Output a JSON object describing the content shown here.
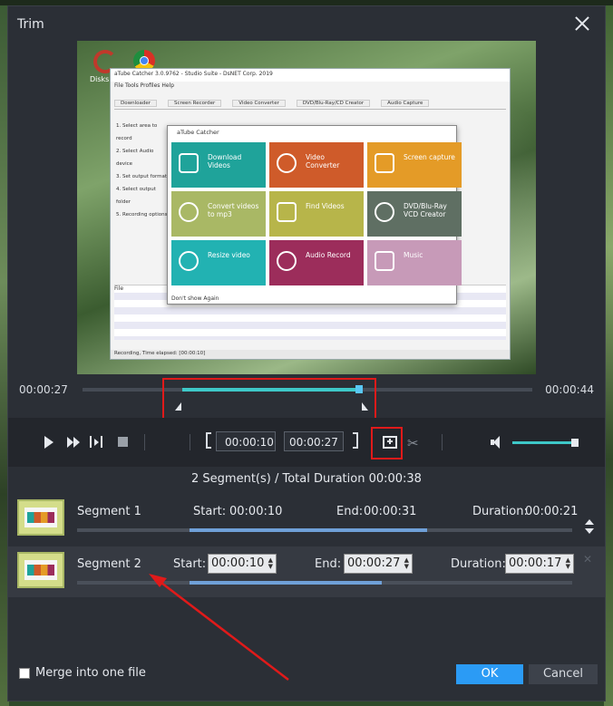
{
  "dialog": {
    "title": "Trim"
  },
  "desktop": {
    "icon_label": "Disks"
  },
  "preview": {
    "app_title": "aTube Catcher 3.0.9762 - Studio Suite - DsNET Corp. 2019",
    "app_menu": "File   Tools   Profiles   Help",
    "app_tabs": [
      "Downloader",
      "Screen Recorder",
      "Video Converter",
      "DVD/Blu-Ray/CD Creator",
      "Audio Capture"
    ],
    "app_left": [
      "1. Select area to record",
      "2. Select Audio device",
      "3. Set output format",
      "4. Select output folder",
      "5. Recording options"
    ],
    "app_grid_header": "File",
    "app_status": "Recording, Time elapsed: [00:00:10]",
    "popup_title": "aTube Catcher",
    "tiles": [
      {
        "label": "Download Videos",
        "color": "#1fa39a"
      },
      {
        "label": "Video Converter",
        "color": "#cf5b2a"
      },
      {
        "label": "Screen capture",
        "color": "#e49b27"
      },
      {
        "label": "Convert videos to mp3",
        "color": "#a9b865"
      },
      {
        "label": "Find Videos",
        "color": "#b7b54a"
      },
      {
        "label": "DVD/Blu-Ray VCD Creator",
        "color": "#5f6f63"
      },
      {
        "label": "Resize video",
        "color": "#22b2b2"
      },
      {
        "label": "Audio Record",
        "color": "#9c2d5b"
      },
      {
        "label": "Music",
        "color": "#c79ab8"
      }
    ],
    "popup_footer": "Don't show Again"
  },
  "timeline": {
    "start_time": "00:00:27",
    "end_time": "00:00:44"
  },
  "controls": {
    "in_time": "00:00:10",
    "out_time": "00:00:27",
    "scissors_glyph": "✂"
  },
  "summary": "2 Segment(s) / Total Duration 00:00:38",
  "labels": {
    "start": "Start:",
    "end": "End:",
    "duration": "Duration:"
  },
  "segments": [
    {
      "name": "Segment 1",
      "start": "00:00:10",
      "end": "00:00:31",
      "duration": "00:00:21"
    },
    {
      "name": "Segment 2",
      "start": "00:00:10",
      "end": "00:00:27",
      "duration": "00:00:17"
    }
  ],
  "footer": {
    "merge_label": "Merge into one file",
    "ok": "OK",
    "cancel": "Cancel"
  },
  "colors": {
    "accent": "#3ec8c8",
    "highlight": "#e01a1a",
    "ok_button": "#2b9bf5"
  }
}
